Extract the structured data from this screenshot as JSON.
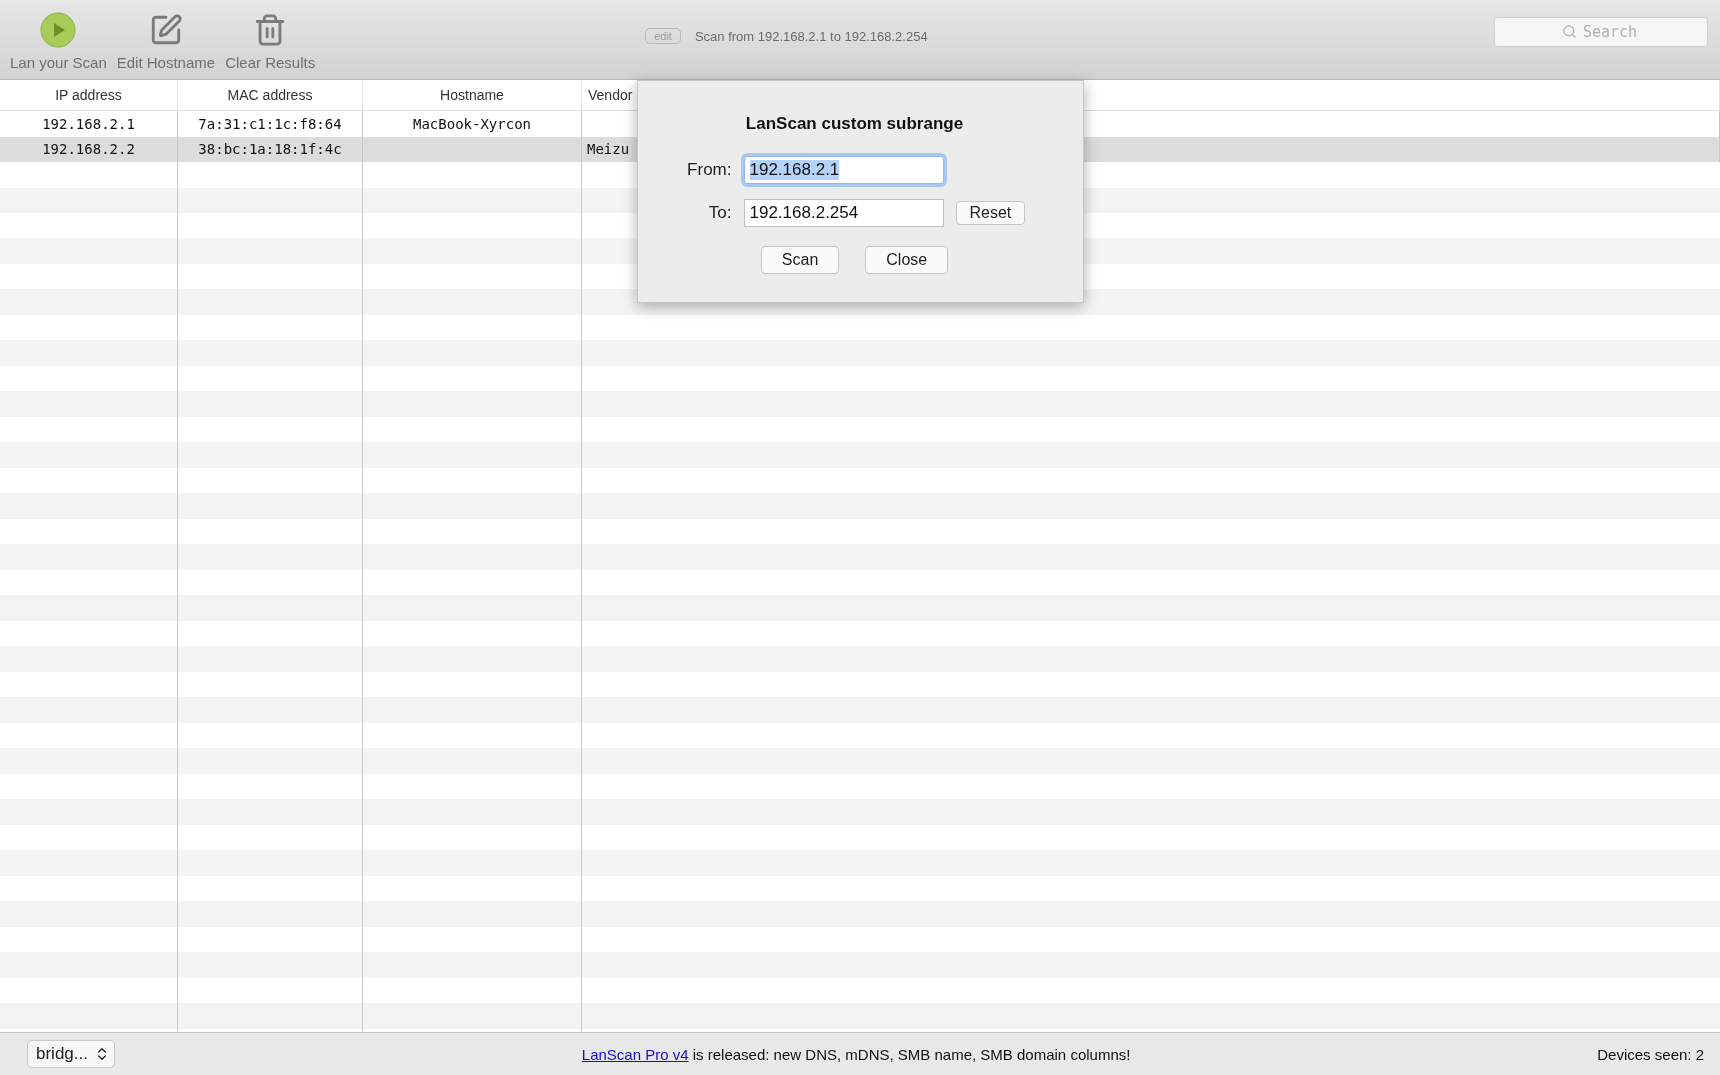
{
  "toolbar": {
    "buttons": [
      {
        "kind": "play",
        "label": "Lan your Scan"
      },
      {
        "kind": "edit",
        "label": "Edit Hostname"
      },
      {
        "kind": "trash",
        "label": "Clear Results"
      }
    ],
    "edit_badge": "edit",
    "scan_range": "Scan from 192.168.2.1 to 192.168.2.254",
    "search": {
      "placeholder": "Search"
    }
  },
  "table": {
    "columns": [
      "IP address",
      "MAC address",
      "Hostname",
      "Vendor"
    ],
    "rows": [
      {
        "cells": [
          "192.168.2.1",
          "7a:31:c1:1c:f8:64",
          "MacBook-Xyrcon",
          ""
        ],
        "selected": false
      },
      {
        "cells": [
          "192.168.2.2",
          "38:bc:1a:18:1f:4c",
          "",
          "Meizu"
        ],
        "selected": true
      }
    ]
  },
  "dialog": {
    "title": "LanScan custom subrange",
    "from": {
      "label": "From:",
      "value": "192.168.2.1",
      "focused": true,
      "text_selected": true
    },
    "to": {
      "label": "To:",
      "value": "192.168.2.254",
      "focused": false,
      "text_selected": false
    },
    "reset": "Reset",
    "buttons": [
      "Scan",
      "Close"
    ]
  },
  "status_bar": {
    "interface": "bridg...",
    "notice_link": "LanScan Pro v4",
    "notice_text": " is released: new DNS, mDNS, SMB name, SMB domain columns!",
    "devices": "Devices seen: 2"
  }
}
